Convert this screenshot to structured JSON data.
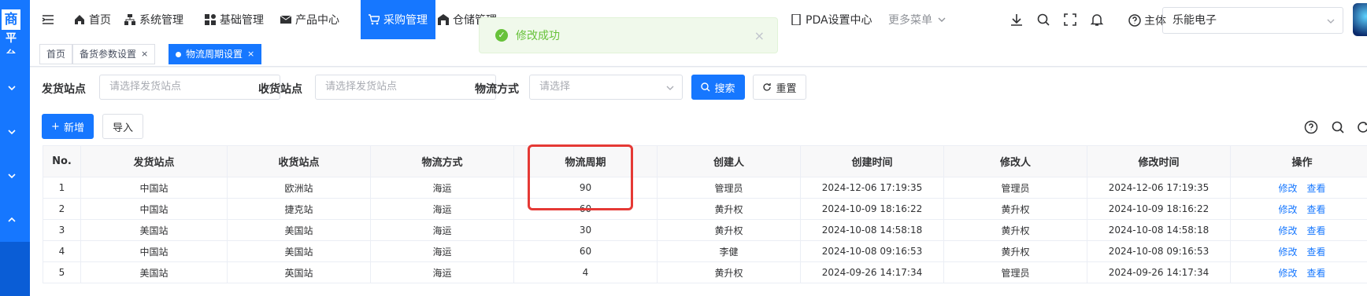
{
  "sidebar": {
    "logo_line1": "商",
    "logo_line2": "平台"
  },
  "topnav": {
    "items": [
      {
        "label": "首页",
        "icon": "home-icon"
      },
      {
        "label": "系统管理",
        "icon": "sitemap-icon"
      },
      {
        "label": "基础管理",
        "icon": "grid-icon"
      },
      {
        "label": "产品中心",
        "icon": "mail-icon"
      },
      {
        "label": "采购管理",
        "icon": "cart-icon",
        "active": true
      },
      {
        "label": "仓储管理",
        "icon": "warehouse-icon"
      },
      {
        "label": "PDA设置中心",
        "icon": "device-icon"
      },
      {
        "label": "更多菜单",
        "icon": "chevron-down-icon"
      }
    ],
    "theme_label": "主体",
    "company": "乐能电子"
  },
  "tabs": [
    {
      "label": "首页"
    },
    {
      "label": "备货参数设置",
      "closable": true
    },
    {
      "label": "物流周期设置",
      "closable": true,
      "active": true
    }
  ],
  "toast": {
    "message": "修改成功",
    "close": "×",
    "color": "#67c23a"
  },
  "search": {
    "from_label": "发货站点",
    "from_placeholder": "请选择发货站点",
    "to_label": "收货站点",
    "to_placeholder": "请选择发货站点",
    "method_label": "物流方式",
    "method_placeholder": "请选择",
    "search_button": "搜索",
    "reset_button": "重置"
  },
  "toolbar": {
    "add_button": "新增",
    "import_button": "导入"
  },
  "table": {
    "columns": [
      "No.",
      "发货站点",
      "收货站点",
      "物流方式",
      "物流周期",
      "创建人",
      "创建时间",
      "修改人",
      "修改时间",
      "操作"
    ],
    "rows": [
      {
        "no": "1",
        "from": "中国站",
        "to": "欧洲站",
        "method": "海运",
        "cycle": "90",
        "creator": "管理员",
        "created": "2024-12-06 17:19:35",
        "modifier": "管理员",
        "modified": "2024-12-06 17:19:35"
      },
      {
        "no": "2",
        "from": "中国站",
        "to": "捷克站",
        "method": "海运",
        "cycle": "60",
        "creator": "黄升权",
        "created": "2024-10-09 18:16:22",
        "modifier": "黄升权",
        "modified": "2024-10-09 18:16:22"
      },
      {
        "no": "3",
        "from": "美国站",
        "to": "美国站",
        "method": "海运",
        "cycle": "30",
        "creator": "黄升权",
        "created": "2024-10-08 14:58:18",
        "modifier": "黄升权",
        "modified": "2024-10-08 14:58:18"
      },
      {
        "no": "4",
        "from": "中国站",
        "to": "美国站",
        "method": "海运",
        "cycle": "60",
        "creator": "李健",
        "created": "2024-10-08 09:16:53",
        "modifier": "黄升权",
        "modified": "2024-10-08 09:16:53"
      },
      {
        "no": "5",
        "from": "美国站",
        "to": "英国站",
        "method": "海运",
        "cycle": "4",
        "creator": "黄升权",
        "created": "2024-09-26 14:17:34",
        "modifier": "管理员",
        "modified": "2024-09-26 14:17:34"
      }
    ],
    "edit_label": "修改",
    "view_label": "查看"
  },
  "colors": {
    "primary": "#1677ff",
    "highlight": "#e53935",
    "success": "#67c23a"
  }
}
